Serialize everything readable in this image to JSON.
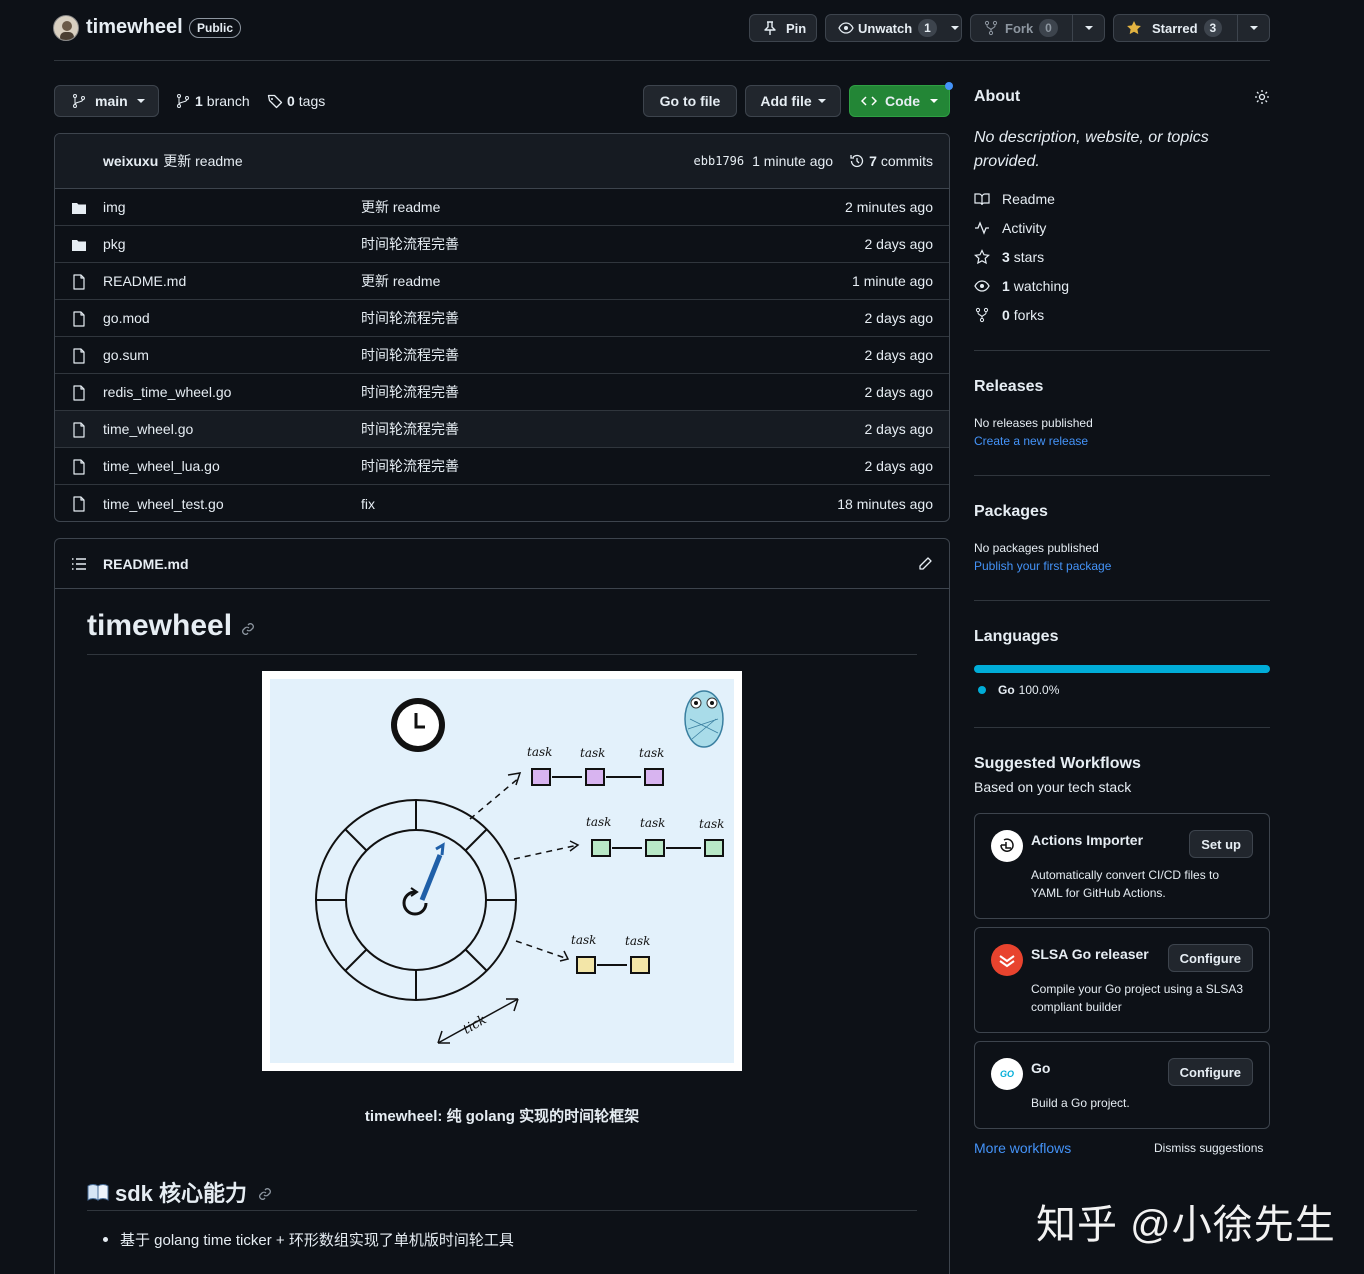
{
  "repo": {
    "name": "timewheel",
    "visibility": "Public"
  },
  "actions": {
    "pin": "Pin",
    "unwatch": "Unwatch",
    "watch_count": "1",
    "fork": "Fork",
    "fork_count": "0",
    "starred": "Starred",
    "star_count": "3"
  },
  "toolbar": {
    "branch": "main",
    "branch_count": "1",
    "branch_label": "branch",
    "tags_count": "0",
    "tags_label": "tags",
    "go_to_file": "Go to file",
    "add_file": "Add file",
    "code": "Code"
  },
  "commit": {
    "author": "weixuxu",
    "message": "更新 readme",
    "hash": "ebb1796",
    "time": "1 minute ago",
    "commits_count": "7",
    "commits_label": "commits"
  },
  "files": [
    {
      "name": "img",
      "type": "dir",
      "message": "更新 readme",
      "age": "2 minutes ago"
    },
    {
      "name": "pkg",
      "type": "dir",
      "message": "时间轮流程完善",
      "age": "2 days ago"
    },
    {
      "name": "README.md",
      "type": "file",
      "message": "更新 readme",
      "age": "1 minute ago"
    },
    {
      "name": "go.mod",
      "type": "file",
      "message": "时间轮流程完善",
      "age": "2 days ago"
    },
    {
      "name": "go.sum",
      "type": "file",
      "message": "时间轮流程完善",
      "age": "2 days ago"
    },
    {
      "name": "redis_time_wheel.go",
      "type": "file",
      "message": "时间轮流程完善",
      "age": "2 days ago"
    },
    {
      "name": "time_wheel.go",
      "type": "file",
      "message": "时间轮流程完善",
      "age": "2 days ago"
    },
    {
      "name": "time_wheel_lua.go",
      "type": "file",
      "message": "时间轮流程完善",
      "age": "2 days ago"
    },
    {
      "name": "time_wheel_test.go",
      "type": "file",
      "message": "fix",
      "age": "18 minutes ago"
    }
  ],
  "readme": {
    "filename": "README.md",
    "title": "timewheel",
    "diagram": {
      "task": "task",
      "tick": "tick"
    },
    "caption": "timewheel: 纯 golang 实现的时间轮框架",
    "section_title": "sdk 核心能力",
    "bullets": [
      "基于 golang time ticker + 环形数组实现了单机版时间轮工具"
    ]
  },
  "about": {
    "heading": "About",
    "description": "No description, website, or topics provided.",
    "links": {
      "readme": "Readme",
      "activity": "Activity",
      "stars_count": "3",
      "stars_label": "stars",
      "watching_count": "1",
      "watching_label": "watching",
      "forks_count": "0",
      "forks_label": "forks"
    }
  },
  "releases": {
    "heading": "Releases",
    "empty": "No releases published",
    "link": "Create a new release"
  },
  "packages": {
    "heading": "Packages",
    "empty": "No packages published",
    "link": "Publish your first package"
  },
  "languages": {
    "heading": "Languages",
    "items": [
      {
        "name": "Go",
        "percent": "100.0%",
        "color": "#00add8"
      }
    ]
  },
  "workflows": {
    "heading": "Suggested Workflows",
    "subheading": "Based on your tech stack",
    "items": [
      {
        "title": "Actions Importer",
        "button": "Set up",
        "desc": "Automatically convert CI/CD files to YAML for GitHub Actions."
      },
      {
        "title": "SLSA Go releaser",
        "button": "Configure",
        "desc": "Compile your Go project using a SLSA3 compliant builder"
      },
      {
        "title": "Go",
        "button": "Configure",
        "desc": "Build a Go project.",
        "icon_text": "GO"
      }
    ],
    "more": "More workflows",
    "dismiss": "Dismiss suggestions"
  },
  "watermark": "知乎 @小徐先生"
}
